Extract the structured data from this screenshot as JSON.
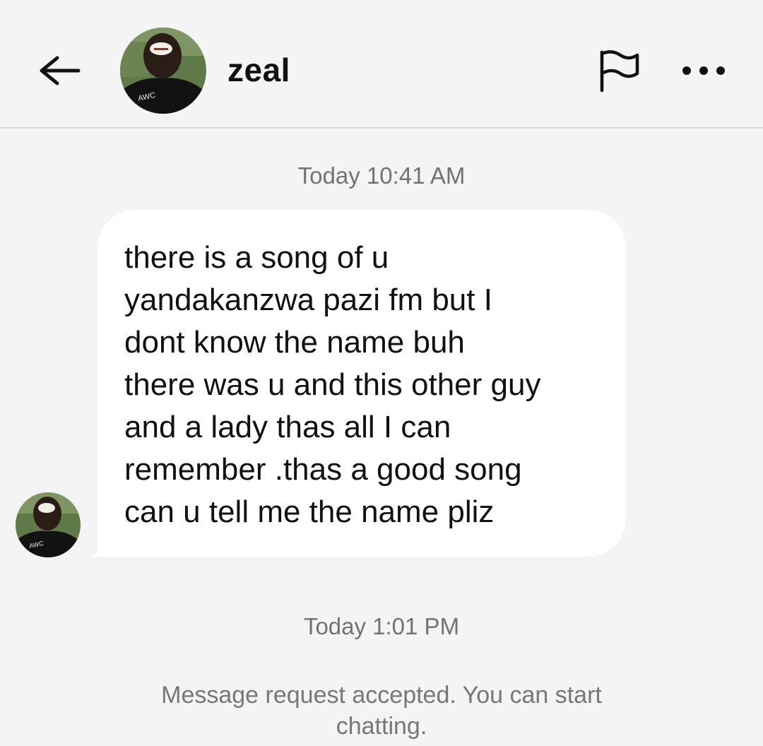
{
  "header": {
    "back_icon": "arrow-left-icon",
    "contact_name": "zeal",
    "avatar_icon": "profile-photo",
    "flag_icon": "flag-icon",
    "more_icon": "more-horizontal-icon"
  },
  "conversation": {
    "timestamp_1": "Today 10:41 AM",
    "message": {
      "lines": [
        "there is a song of u",
        "yandakanzwa pazi fm but I",
        "dont know the name buh",
        "there was u and this other guy",
        "and a lady thas all I can",
        "remember .thas a good song",
        "can u tell me the name pliz"
      ]
    },
    "timestamp_2": "Today 1:01 PM",
    "system_message": "Message request accepted. You can start chatting."
  },
  "colors": {
    "background": "#f4f4f4",
    "bubble": "#ffffff",
    "muted_text": "#777777",
    "divider": "#d9d9d9"
  }
}
